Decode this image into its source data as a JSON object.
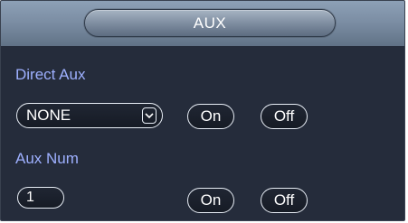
{
  "window": {
    "title": "AUX"
  },
  "direct_aux": {
    "label": "Direct Aux",
    "select_value": "NONE",
    "on_label": "On",
    "off_label": "Off"
  },
  "aux_num": {
    "label": "Aux Num",
    "value": "1",
    "on_label": "On",
    "off_label": "Off"
  },
  "icons": {
    "dropdown": "chevron-down-icon"
  },
  "colors": {
    "label": "#9eb0ff",
    "panel_bg": "#252c3b",
    "header_bg": "#7a8ca2"
  }
}
